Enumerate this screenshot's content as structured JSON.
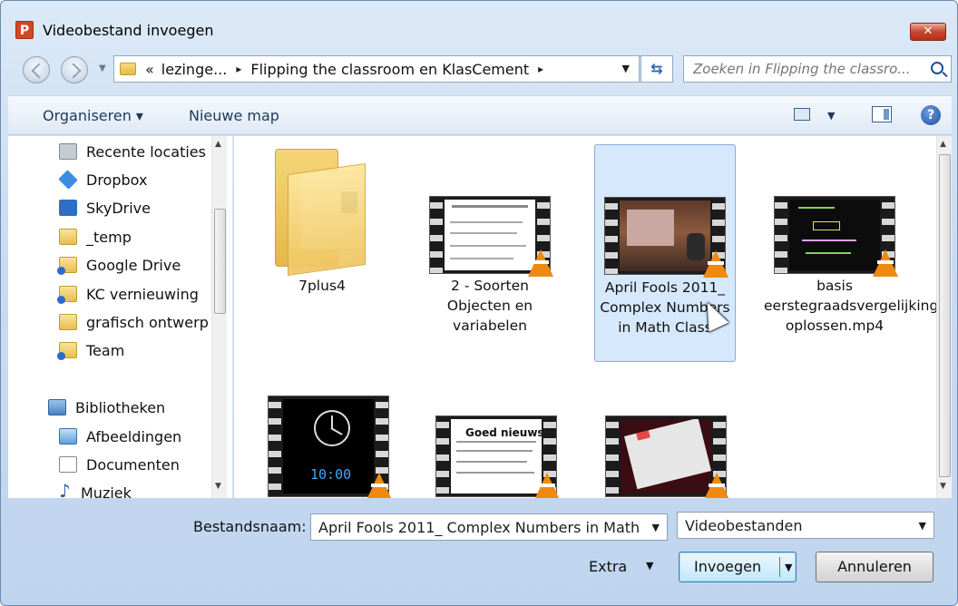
{
  "window": {
    "title": "Videobestand invoegen",
    "app_icon_letter": "P",
    "close_label": "✕"
  },
  "address": {
    "overflow": "«",
    "segments": [
      "lezinge...",
      "Flipping the classroom en KlasCement"
    ],
    "separator": "▸"
  },
  "search": {
    "placeholder": "Zoeken in Flipping the classro..."
  },
  "toolbar": {
    "organize_label": "Organiseren ▾",
    "new_folder_label": "Nieuwe map",
    "help_label": "?"
  },
  "navpane": {
    "items": [
      {
        "label": "Recente locaties",
        "icon": "recent-places-icon"
      },
      {
        "label": "Dropbox",
        "icon": "dropbox-icon"
      },
      {
        "label": "SkyDrive",
        "icon": "skydrive-icon"
      },
      {
        "label": "_temp",
        "icon": "folder-icon"
      },
      {
        "label": "Google Drive",
        "icon": "shared-folder-icon"
      },
      {
        "label": "KC vernieuwing",
        "icon": "shared-folder-icon"
      },
      {
        "label": "grafisch ontwerp",
        "icon": "folder-icon"
      },
      {
        "label": "Team",
        "icon": "shared-folder-icon"
      }
    ],
    "libraries": {
      "label": "Bibliotheken",
      "items": [
        {
          "label": "Afbeeldingen",
          "icon": "pictures-icon"
        },
        {
          "label": "Documenten",
          "icon": "documents-icon"
        },
        {
          "label": "Muziek",
          "icon": "music-icon"
        }
      ]
    }
  },
  "files": [
    {
      "name": "7plus4",
      "kind": "folder"
    },
    {
      "name": "2 - Soorten Objecten en variabelen",
      "kind": "video"
    },
    {
      "name": "April Fools 2011_ Complex Numbers in Math Class",
      "kind": "video",
      "selected": true
    },
    {
      "name": "basis eerstegraadsvergelijking oplossen.mp4",
      "kind": "video"
    },
    {
      "name": "",
      "kind": "video",
      "clock_text": "10:00"
    },
    {
      "name": "",
      "kind": "video",
      "slide_title": "Goed nieuws:"
    },
    {
      "name": "",
      "kind": "video"
    }
  ],
  "footer": {
    "filename_label": "Bestandsnaam:",
    "filename_value": "April Fools 2011_ Complex Numbers in Math",
    "filetype_value": "Videobestanden",
    "extra_label": "Extra",
    "insert_label": "Invoegen",
    "cancel_label": "Annuleren"
  },
  "colors": {
    "selection_bg": "#d6e8fb",
    "vlc_orange": "#f08a0e",
    "chrome_blue": "#c9dcf1"
  }
}
